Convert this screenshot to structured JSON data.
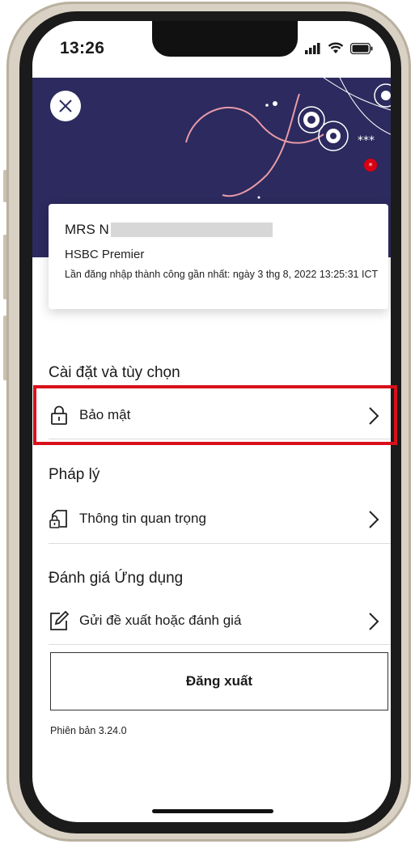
{
  "status_bar": {
    "time": "13:26"
  },
  "profile": {
    "name": "MRS N",
    "tier": "HSBC Premier",
    "last_login": "Lần đăng nhập thành công gần nhất: ngày 3 thg 8, 2022 13:25:31 ICT"
  },
  "sections": {
    "settings": {
      "title": "Cài đặt và tùy chọn",
      "items": [
        {
          "label": "Bảo mật",
          "icon": "lock-icon"
        }
      ]
    },
    "legal": {
      "title": "Pháp lý",
      "items": [
        {
          "label": "Thông tin quan trọng",
          "icon": "document-lock-icon"
        }
      ]
    },
    "rating": {
      "title": "Đánh giá Ứng dụng",
      "items": [
        {
          "label": "Gửi đề xuất hoặc đánh giá",
          "icon": "edit-icon"
        }
      ]
    }
  },
  "logout_label": "Đăng xuất",
  "version": "Phiên bản 3.24.0",
  "colors": {
    "banner": "#2c2a5e",
    "highlight": "#d8101b",
    "accent_red": "#db0011"
  }
}
